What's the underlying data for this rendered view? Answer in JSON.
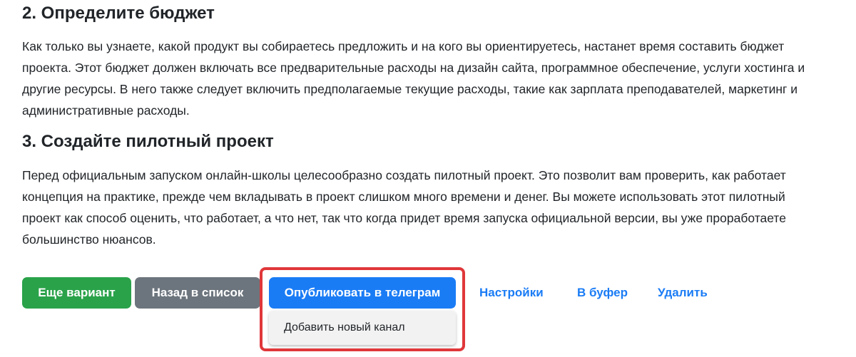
{
  "article": {
    "sections": [
      {
        "heading": "2. Определите бюджет",
        "paragraph": "Как только вы узнаете, какой продукт вы собираетесь предложить и на кого вы ориентируетесь, настанет время составить бюджет проекта. Этот бюджет должен включать все предварительные расходы на дизайн сайта, программное обеспечение, услуги хостинга и другие ресурсы. В него также следует включить предполагаемые текущие расходы, такие как зарплата преподавателей, маркетинг и административные расходы."
      },
      {
        "heading": "3. Создайте пилотный проект",
        "paragraph": "Перед официальным запуском онлайн-школы целесообразно создать пилотный проект. Это позволит вам проверить, как работает концепция на практике, прежде чем вкладывать в проект слишком много времени и денег. Вы можете использовать этот пилотный проект как способ оценить, что работает, а что нет, так что когда придет время запуска официальной версии, вы уже проработаете большинство нюансов."
      }
    ]
  },
  "actions": {
    "another_variant": "Еще вариант",
    "back_to_list": "Назад в список",
    "publish_telegram": "Опубликовать в телеграм",
    "settings": "Настройки",
    "to_buffer": "В буфер",
    "delete": "Удалить"
  },
  "dropdown": {
    "items": [
      "Добавить новый канал"
    ]
  },
  "colors": {
    "success": "#2aa24a",
    "secondary": "#6c757d",
    "primary": "#1a7cf5",
    "highlight": "#e0373a"
  }
}
